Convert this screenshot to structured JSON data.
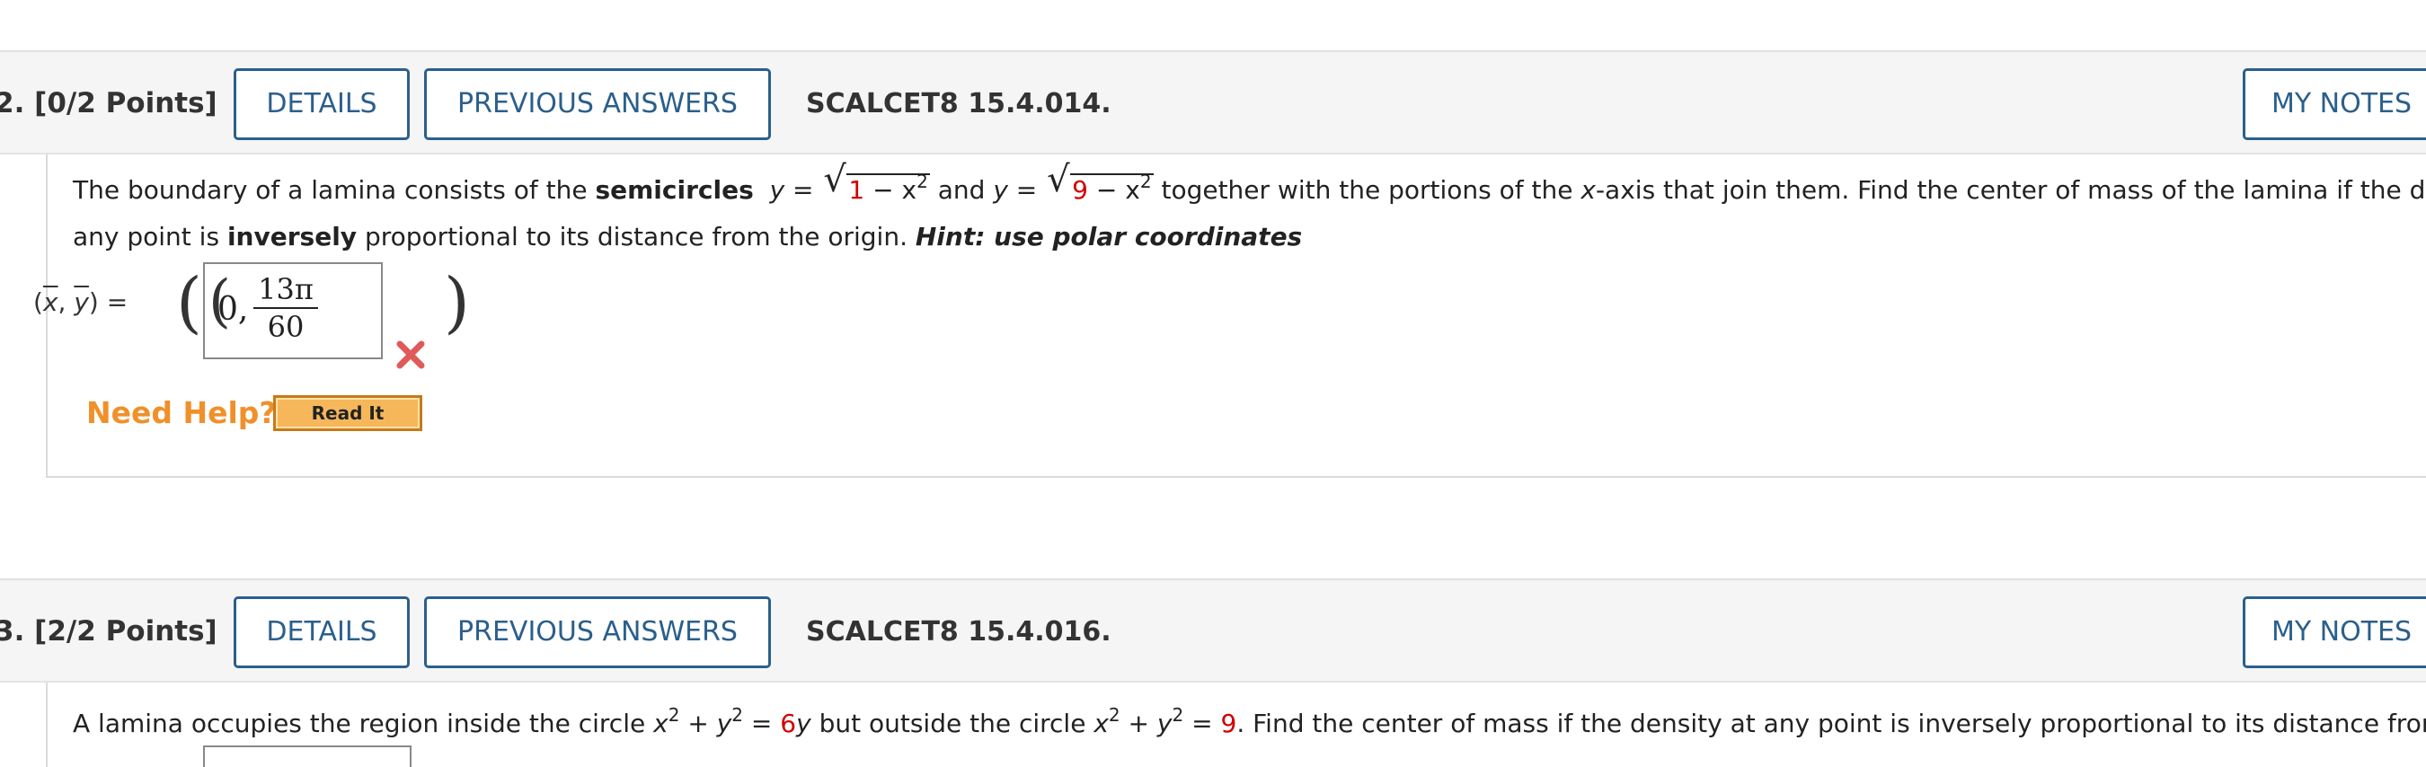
{
  "questions": [
    {
      "number": "2.",
      "points": "[0/2 Points]",
      "details_label": "DETAILS",
      "prev_answers_label": "PREVIOUS ANSWERS",
      "code": "SCALCET8 15.4.014.",
      "notes_label": "MY NOTES",
      "text": {
        "t1": "The boundary of a lamina consists of the ",
        "t1_bold": "semicircles",
        "y_eq_1": "y",
        "eq": " = ",
        "rad1_a": "1",
        "rad1_b": " − x",
        "exp": "2",
        "and": " and ",
        "y_eq_2": "y",
        "rad2_a": "9",
        "rad2_b": " − x",
        "t2": " together with the portions of the ",
        "x_axis": "x",
        "t3": "-axis that join them. Find the center of mass of the lamina if the density at",
        "line2_a": "any point is ",
        "line2_bold": "inversely",
        "line2_b": " proportional to its distance from the origin. ",
        "hint": "Hint: use polar coordinates"
      },
      "answer_label": "(x, y) =",
      "answer_zero": "0,",
      "answer_num": "13π",
      "answer_den": "60",
      "status": "incorrect",
      "need_help_label": "Need Help?",
      "read_it_label": "Read It"
    },
    {
      "number": "3.",
      "points": "[2/2 Points]",
      "details_label": "DETAILS",
      "prev_answers_label": "PREVIOUS ANSWERS",
      "code": "SCALCET8 15.4.016.",
      "notes_label": "MY NOTES",
      "text": {
        "t1": "A lamina occupies the region inside the circle ",
        "c1": "x",
        "exp": "2",
        "plus": " + ",
        "c2": "y",
        "eq": " = ",
        "v1": "6",
        "yvar": "y",
        "t2": " but outside the circle ",
        "v2": "9",
        "t3": ". Find the center of mass if the density at any point is inversely proportional to its distance from the origin"
      }
    }
  ],
  "colors": {
    "accent": "#2b5f8c",
    "header_bg": "#f5f5f5",
    "value_red": "#d20000",
    "need_help": "#f0902a",
    "read_it_bg": "#f6b75a",
    "wrong_icon": "#e05a5a"
  }
}
